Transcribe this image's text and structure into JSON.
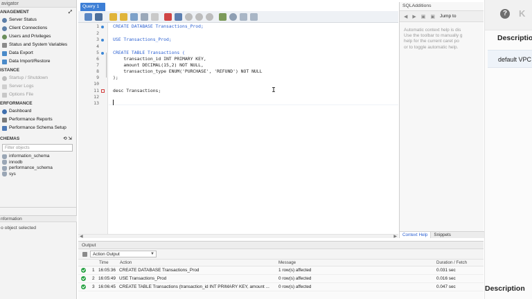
{
  "navigator": {
    "title": "avigator",
    "management": {
      "header": "ANAGEMENT",
      "items": [
        "Server Status",
        "Client Connections",
        "Users and Privileges",
        "Status and System Variables",
        "Data Export",
        "Data Import/Restore"
      ]
    },
    "instance": {
      "header": "ISTANCE",
      "items": [
        "Startup / Shutdown",
        "Server Logs",
        "Options File"
      ]
    },
    "performance": {
      "header": "ERFORMANCE",
      "items": [
        "Dashboard",
        "Performance Reports",
        "Performance Schema Setup"
      ]
    },
    "schemas": {
      "header": "CHEMAS",
      "filter_placeholder": "Filter objects",
      "items": [
        "information_schema",
        "innodb",
        "performance_schema",
        "sys"
      ]
    },
    "information": {
      "header": "nformation",
      "text": "o object selected"
    }
  },
  "editor": {
    "tab_label": "Query 1",
    "line_numbers": [
      "1",
      "2",
      "3",
      "4",
      "5",
      "6",
      "7",
      "8",
      "9",
      "10",
      "11",
      "12",
      "13"
    ],
    "code": {
      "l1": "CREATE DATABASE Transactions_Prod;",
      "l3": "USE Transactions_Prod;",
      "l5": "CREATE TABLE Transactions (",
      "l6": "    transaction_id INT PRIMARY KEY,",
      "l7": "    amount DECIMAL(15,2) NOT NULL,",
      "l8": "    transaction_type ENUM('PURCHASE', 'REFUND') NOT NULL",
      "l9": ");",
      "l11": "desc Transactions;"
    }
  },
  "sql_additions": {
    "title": "SQLAdditions",
    "jump_label": "Jump to",
    "help_lines": [
      "Automatic context help is dis",
      "Use the toolbar to manually g",
      "help for the current caret po",
      "or to toggle automatic help."
    ],
    "tabs": [
      "Context Help",
      "Snippets"
    ]
  },
  "output": {
    "title": "Output",
    "selector": "Action Output",
    "headers": {
      "time": "Time",
      "action": "Action",
      "message": "Message",
      "duration": "Duration / Fetch"
    },
    "rows": [
      {
        "num": "1",
        "time": "16:05:36",
        "action": "CREATE DATABASE Transactions_Prod",
        "message": "1 row(s) affected",
        "duration": "0.031 sec"
      },
      {
        "num": "2",
        "time": "16:05:49",
        "action": "USE Transactions_Prod",
        "message": "0 row(s) affected",
        "duration": "0.016 sec"
      },
      {
        "num": "3",
        "time": "16:06:45",
        "action": "CREATE TABLE Transactions (transaction_id INT PRIMARY KEY, amount ...",
        "message": "0 row(s) affected",
        "duration": "0.047 sec"
      }
    ]
  },
  "right_window": {
    "help_icon": "?",
    "k_label": "K",
    "description_header": "Description",
    "row_value": "default VPC",
    "description_header_bottom": "Description"
  }
}
